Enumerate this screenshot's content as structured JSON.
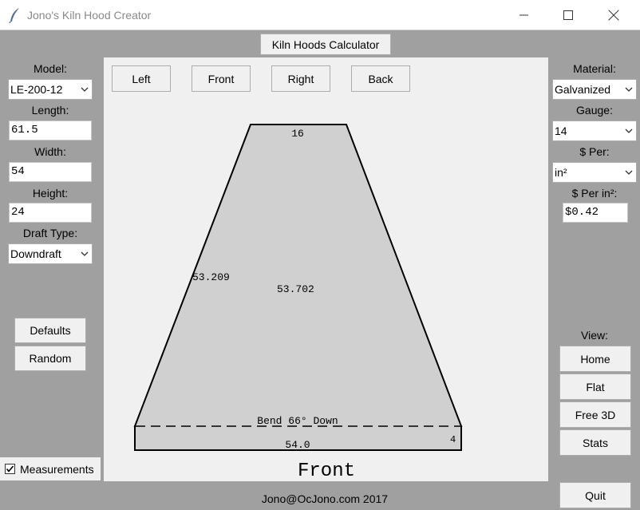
{
  "window": {
    "title": "Jono's Kiln Hood Creator",
    "icon": "feather-icon",
    "controls": [
      "minimize-icon",
      "maximize-icon",
      "close-icon"
    ]
  },
  "header": {
    "calculator_button": "Kiln Hoods Calculator"
  },
  "left_panel": {
    "model_label": "Model:",
    "model_value": "LE-200-12",
    "length_label": "Length:",
    "length_value": "61.5",
    "width_label": "Width:",
    "width_value": "54",
    "height_label": "Height:",
    "height_value": "24",
    "draft_label": "Draft Type:",
    "draft_value": "Downdraft",
    "defaults_button": "Defaults",
    "random_button": "Random",
    "measurements_label": "Measurements",
    "measurements_checked": true
  },
  "view_buttons": {
    "left": "Left",
    "front": "Front",
    "right": "Right",
    "back": "Back"
  },
  "drawing": {
    "top_width": "16",
    "side_length": "53.209",
    "center_length": "53.702",
    "bend_note": "Bend 66° Down",
    "bottom_width": "54.0",
    "lip_height": "4",
    "view_name": "Front",
    "fill_color": "#d0d0d0"
  },
  "right_panel": {
    "material_label": "Material:",
    "material_value": "Galvanized",
    "gauge_label": "Gauge:",
    "gauge_value": "14",
    "per_label": "$ Per:",
    "per_value": "in²",
    "price_label": "$ Per in²:",
    "price_value": "$0.42",
    "view_label": "View:",
    "home_button": "Home",
    "flat_button": "Flat",
    "free3d_button": "Free 3D",
    "stats_button": "Stats",
    "quit_button": "Quit"
  },
  "footer": {
    "credit": "Jono@OcJono.com 2017"
  }
}
